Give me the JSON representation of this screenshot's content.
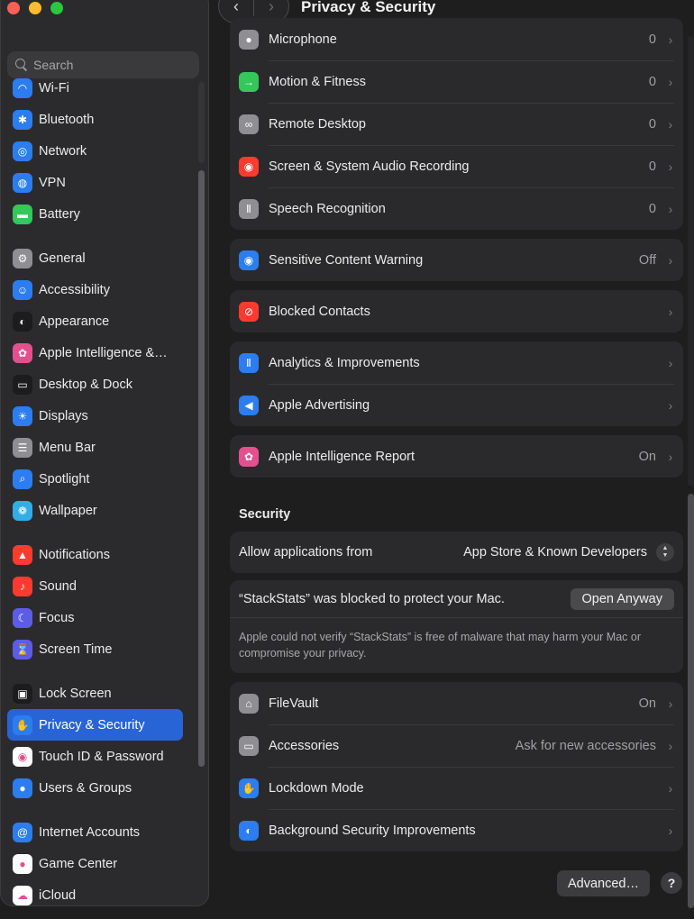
{
  "window": {
    "title": "Privacy & Security"
  },
  "search": {
    "placeholder": "Search"
  },
  "sidebar": {
    "items": [
      {
        "label": "Wi-Fi",
        "icon": "wifi-icon",
        "color": "#2b7df0",
        "glyph": "◠"
      },
      {
        "label": "Bluetooth",
        "icon": "bluetooth-icon",
        "color": "#2b7df0",
        "glyph": "✱"
      },
      {
        "label": "Network",
        "icon": "globe-icon",
        "color": "#2b7df0",
        "glyph": "◎"
      },
      {
        "label": "VPN",
        "icon": "vpn-icon",
        "color": "#2b7df0",
        "glyph": "◍"
      },
      {
        "label": "Battery",
        "icon": "battery-icon",
        "color": "#34c759",
        "glyph": "▬"
      },
      {
        "label": "General",
        "icon": "gear-icon",
        "color": "#8e8e93",
        "glyph": "⚙"
      },
      {
        "label": "Accessibility",
        "icon": "accessibility-icon",
        "color": "#2b7df0",
        "glyph": "☺"
      },
      {
        "label": "Appearance",
        "icon": "appearance-icon",
        "color": "#1c1c1e",
        "glyph": "◐"
      },
      {
        "label": "Apple Intelligence &…",
        "icon": "apple-intelligence-icon",
        "color": "#e4508e",
        "glyph": "✿"
      },
      {
        "label": "Desktop & Dock",
        "icon": "desktop-dock-icon",
        "color": "#1c1c1e",
        "glyph": "▭"
      },
      {
        "label": "Displays",
        "icon": "displays-icon",
        "color": "#2b7df0",
        "glyph": "☀"
      },
      {
        "label": "Menu Bar",
        "icon": "menu-bar-icon",
        "color": "#8e8e93",
        "glyph": "☰"
      },
      {
        "label": "Spotlight",
        "icon": "spotlight-icon",
        "color": "#2b7df0",
        "glyph": "⌕"
      },
      {
        "label": "Wallpaper",
        "icon": "wallpaper-icon",
        "color": "#32ade6",
        "glyph": "❁"
      },
      {
        "label": "Notifications",
        "icon": "notifications-icon",
        "color": "#ff3b30",
        "glyph": "▲"
      },
      {
        "label": "Sound",
        "icon": "sound-icon",
        "color": "#ff3b30",
        "glyph": "♪"
      },
      {
        "label": "Focus",
        "icon": "focus-moon-icon",
        "color": "#5e5ce6",
        "glyph": "☾"
      },
      {
        "label": "Screen Time",
        "icon": "hourglass-icon",
        "color": "#5e5ce6",
        "glyph": "⌛"
      },
      {
        "label": "Lock Screen",
        "icon": "lock-icon",
        "color": "#1c1c1e",
        "glyph": "▣"
      },
      {
        "label": "Privacy & Security",
        "icon": "hand-icon",
        "color": "#2b7df0",
        "glyph": "✋",
        "active": true
      },
      {
        "label": "Touch ID & Password",
        "icon": "fingerprint-icon",
        "color": "#ffffff",
        "glyph": "◉"
      },
      {
        "label": "Users & Groups",
        "icon": "users-icon",
        "color": "#2b7df0",
        "glyph": "●"
      },
      {
        "label": "Internet Accounts",
        "icon": "at-icon",
        "color": "#2b7df0",
        "glyph": "@"
      },
      {
        "label": "Game Center",
        "icon": "game-center-icon",
        "color": "#ffffff",
        "glyph": "●"
      },
      {
        "label": "iCloud",
        "icon": "icloud-icon",
        "color": "#ffffff",
        "glyph": "☁"
      }
    ]
  },
  "privacy_rows": [
    {
      "label": "Microphone",
      "value": "0",
      "icon": "microphone-icon",
      "color": "#8e8e93",
      "glyph": "●"
    },
    {
      "label": "Motion & Fitness",
      "value": "0",
      "icon": "motion-fitness-icon",
      "color": "#34c759",
      "glyph": "→"
    },
    {
      "label": "Remote Desktop",
      "value": "0",
      "icon": "binoculars-icon",
      "color": "#8e8e93",
      "glyph": "∞"
    },
    {
      "label": "Screen & System Audio Recording",
      "value": "0",
      "icon": "record-icon",
      "color": "#ff3b30",
      "glyph": "◉"
    },
    {
      "label": "Speech Recognition",
      "value": "0",
      "icon": "waveform-icon",
      "color": "#8e8e93",
      "glyph": "Ⅱ"
    }
  ],
  "sensitive": {
    "label": "Sensitive Content Warning",
    "value": "Off",
    "icon": "eye-icon",
    "color": "#2b7df0",
    "glyph": "◉"
  },
  "blocked_contacts": {
    "label": "Blocked Contacts",
    "icon": "blocked-icon",
    "color": "#ff3b30",
    "glyph": "⊘"
  },
  "analytics_rows": [
    {
      "label": "Analytics & Improvements",
      "icon": "analytics-icon",
      "color": "#2b7df0",
      "glyph": "Ⅱ"
    },
    {
      "label": "Apple Advertising",
      "icon": "megaphone-icon",
      "color": "#2b7df0",
      "glyph": "◀"
    }
  ],
  "ai_report": {
    "label": "Apple Intelligence Report",
    "value": "On",
    "icon": "apple-intelligence-report-icon",
    "color": "#e4508e",
    "glyph": "✿"
  },
  "security": {
    "heading": "Security",
    "allow_label": "Allow applications from",
    "allow_value": "App Store & Known Developers",
    "blocked_text": "“StackStats” was blocked to protect your Mac.",
    "open_anyway": "Open Anyway",
    "note": "Apple could not verify “StackStats” is free of malware that may harm your Mac or compromise your privacy."
  },
  "security_rows": [
    {
      "label": "FileVault",
      "value": "On",
      "icon": "filevault-icon",
      "color": "#8e8e93",
      "glyph": "⌂"
    },
    {
      "label": "Accessories",
      "value": "Ask for new accessories",
      "icon": "accessories-icon",
      "color": "#8e8e93",
      "glyph": "▭"
    },
    {
      "label": "Lockdown Mode",
      "value": "",
      "icon": "lockdown-hand-icon",
      "color": "#2b7df0",
      "glyph": "✋"
    },
    {
      "label": "Background Security Improvements",
      "value": "",
      "icon": "shield-icon",
      "color": "#2b7df0",
      "glyph": "◐"
    }
  ],
  "footer": {
    "advanced": "Advanced…",
    "help": "?"
  }
}
